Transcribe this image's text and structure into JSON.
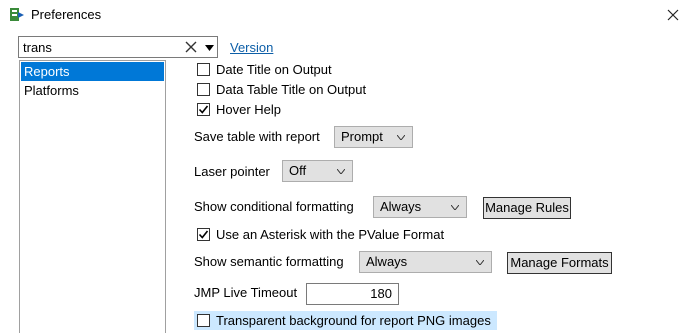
{
  "window": {
    "title": "Preferences",
    "close_icon": "close-icon",
    "app_icon": "jmp-preferences-icon"
  },
  "search": {
    "value": "trans",
    "clear_icon": "clear-icon",
    "dropdown_icon": "chevron-down-icon"
  },
  "version_link": "Version",
  "categories": [
    {
      "label": "Reports",
      "selected": true
    },
    {
      "label": "Platforms",
      "selected": false
    }
  ],
  "options": {
    "date_title": {
      "label": "Date Title on Output",
      "checked": false
    },
    "data_table_title": {
      "label": "Data Table Title on Output",
      "checked": false
    },
    "hover_help": {
      "label": "Hover Help",
      "checked": true
    },
    "save_table": {
      "label": "Save table with report",
      "value": "Prompt"
    },
    "laser_pointer": {
      "label": "Laser pointer",
      "value": "Off"
    },
    "conditional_formatting": {
      "label": "Show conditional formatting",
      "value": "Always",
      "button": "Manage Rules"
    },
    "asterisk_pvalue": {
      "label": "Use an Asterisk with the PValue Format",
      "checked": true
    },
    "semantic_formatting": {
      "label": "Show semantic formatting",
      "value": "Always",
      "button": "Manage Formats"
    },
    "jmp_live_timeout": {
      "label": "JMP Live Timeout",
      "value": "180"
    },
    "transparent_png": {
      "label": "Transparent background for report PNG images",
      "checked": false
    }
  },
  "colors": {
    "selection": "#0078d7",
    "highlight": "#cce8ff",
    "link": "#0d5fa8"
  }
}
